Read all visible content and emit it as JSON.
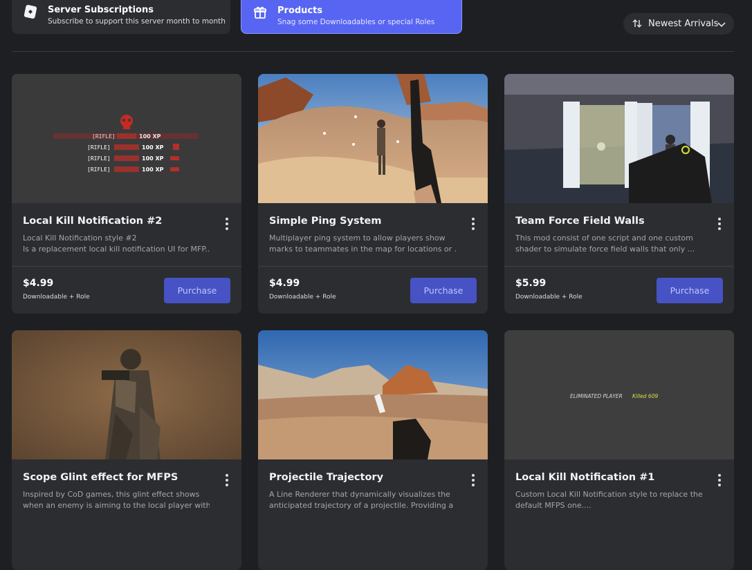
{
  "tabs": [
    {
      "title": "Server Subscriptions",
      "subtitle": "Subscribe to support this server month to month"
    },
    {
      "title": "Products",
      "subtitle": "Snag some Downloadables or special Roles"
    }
  ],
  "sort": {
    "label": "Newest Arrivals"
  },
  "products": [
    {
      "title": "Local Kill Notification #2",
      "desc1": "Local Kill Notification style #2",
      "desc2": "Is a replacement local kill notification UI for MFP...",
      "price": "$4.99",
      "type": "Downloadable + Role",
      "button": "Purchase",
      "thumb_lines": [
        "[RIFLE]",
        "100 XP",
        "[RIFLE]",
        "100 XP",
        "[RIFLE]",
        "100 XP",
        "[RIFLE]",
        "100 XP"
      ]
    },
    {
      "title": "Simple Ping System",
      "desc1": "Multiplayer ping system to allow players show",
      "desc2": "marks to teammates in the map for locations or ...",
      "price": "$4.99",
      "type": "Downloadable + Role",
      "button": "Purchase"
    },
    {
      "title": "Team Force Field Walls",
      "desc1": "This mod consist of one script and one custom",
      "desc2": "shader to simulate force field walls that only ...",
      "price": "$5.99",
      "type": "Downloadable + Role",
      "button": "Purchase"
    },
    {
      "title": "Scope Glint effect for MFPS",
      "desc1": "Inspired by CoD games, this glint effect shows",
      "desc2": "when an enemy is aiming to the local player with ..."
    },
    {
      "title": "Projectile Trajectory",
      "desc1": "A Line Renderer that dynamically visualizes the",
      "desc2": "anticipated trajectory of a projectile. Providing a ..."
    },
    {
      "title": "Local Kill Notification #1",
      "desc1": "Custom Local Kill Notification style to replace the",
      "desc2": "default MFPS one....",
      "thumb_lines": [
        "ELIMINATED PLAYER",
        "Killed 609"
      ]
    }
  ],
  "colors": {
    "accent": "#5865f2",
    "button": "#4752c4",
    "card": "#2b2d31",
    "background": "#1e1f22"
  }
}
